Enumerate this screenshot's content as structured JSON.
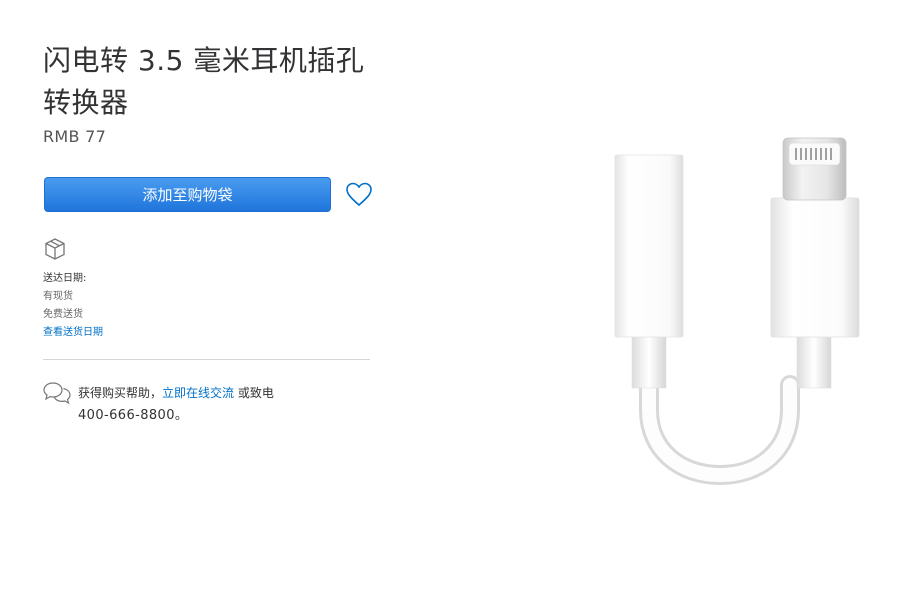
{
  "product": {
    "title": "闪电转 3.5 毫米耳机插孔转换器",
    "price": "RMB 77",
    "image_alt": "闪电转 3.5 毫米耳机插孔转换器"
  },
  "actions": {
    "add_to_bag": "添加至购物袋",
    "favorite_icon": "heart-icon"
  },
  "delivery": {
    "icon": "box-icon",
    "label": "送达日期:",
    "stock": "有现货",
    "shipping": "免费送货",
    "link": "查看送货日期"
  },
  "help": {
    "icon": "chat-bubbles-icon",
    "prefix": "获得购买帮助，",
    "link": "立即在线交流",
    "middle": " 或致电",
    "phone": "400-666-8800。"
  },
  "colors": {
    "accent": "#0070c9",
    "button": "#2a7fdf"
  }
}
